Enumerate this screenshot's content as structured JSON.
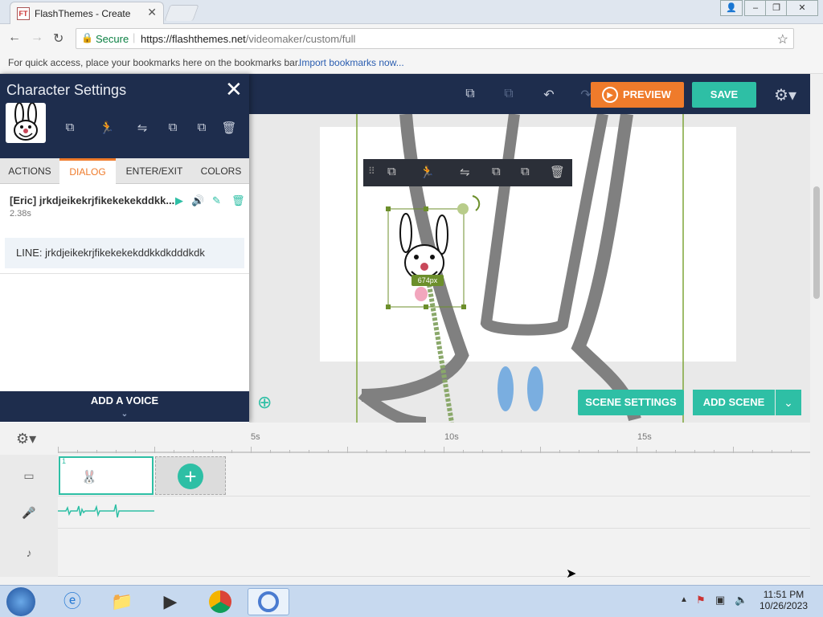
{
  "browser": {
    "tab_title": "FlashThemes - Create",
    "tab_icon_text": "FT",
    "secure_label": "Secure",
    "url_prefix": "https://flashthemes.net",
    "url_path": "/videomaker/custom/full",
    "bookmarks_hint": "For quick access, place your bookmarks here on the bookmarks bar.",
    "bookmarks_link": "Import bookmarks now..."
  },
  "toolbar": {
    "preview_label": "PREVIEW",
    "save_label": "SAVE"
  },
  "character_panel": {
    "title": "Character Settings",
    "tabs": [
      "ACTIONS",
      "DIALOG",
      "ENTER/EXIT",
      "COLORS"
    ],
    "active_tab": "DIALOG",
    "dialog_title": "[Eric] jrkdjeikekrjfikekekekddkk...",
    "dialog_duration": "2.38s",
    "line_text": "LINE: jrkdjeikekrjfikekekekddkkdkdddkdk",
    "add_voice_label": "ADD A VOICE"
  },
  "stage": {
    "distance_badge": "674px"
  },
  "scene_controls": {
    "scene_settings_label": "SCENE SETTINGS",
    "add_scene_label": "ADD SCENE"
  },
  "timeline": {
    "ruler_labels": [
      "5s",
      "10s",
      "15s"
    ],
    "scene_number": "1"
  },
  "taskbar": {
    "time": "11:51 PM",
    "date": "10/26/2023"
  },
  "colors": {
    "navy": "#1e2d4d",
    "orange": "#ef7b2b",
    "teal": "#2ebfa5"
  }
}
